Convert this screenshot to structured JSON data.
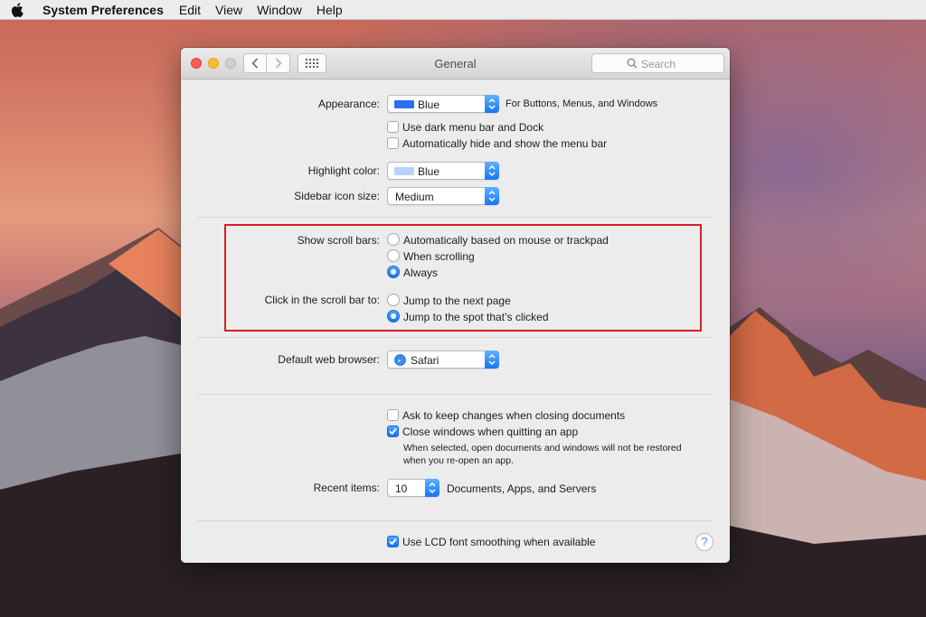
{
  "menubar": {
    "items": [
      "System Preferences",
      "Edit",
      "View",
      "Window",
      "Help"
    ]
  },
  "window": {
    "title": "General",
    "search_placeholder": "Search"
  },
  "appearance": {
    "label": "Appearance:",
    "value": "Blue",
    "note": "For Buttons, Menus, and Windows",
    "swatch_color": "#2d6ff2"
  },
  "dark_menu": {
    "label": "Use dark menu bar and Dock",
    "checked": false
  },
  "auto_hide": {
    "label": "Automatically hide and show the menu bar",
    "checked": false
  },
  "highlight": {
    "label": "Highlight color:",
    "value": "Blue",
    "swatch_color": "#b4d4fa"
  },
  "sidebar_size": {
    "label": "Sidebar icon size:",
    "value": "Medium"
  },
  "scroll_bars": {
    "label": "Show scroll bars:",
    "options": [
      "Automatically based on mouse or trackpad",
      "When scrolling",
      "Always"
    ],
    "selected": 2
  },
  "scroll_click": {
    "label": "Click in the scroll bar to:",
    "options": [
      "Jump to the next page",
      "Jump to the spot that’s clicked"
    ],
    "selected": 1
  },
  "browser": {
    "label": "Default web browser:",
    "value": "Safari"
  },
  "ask_keep": {
    "label": "Ask to keep changes when closing documents",
    "checked": false
  },
  "close_windows": {
    "label": "Close windows when quitting an app",
    "checked": true,
    "note_line1": "When selected, open documents and windows will not be restored",
    "note_line2": "when you re-open an app."
  },
  "recent": {
    "label": "Recent items:",
    "value": "10",
    "suffix": "Documents, Apps, and Servers"
  },
  "lcd": {
    "label": "Use LCD font smoothing when available",
    "checked": true
  },
  "help_label": "?",
  "colors": {
    "accent": "#1870f3",
    "highlight_border": "#d61f26",
    "close_light": "#fc5b57",
    "min_light": "#fdbc2e"
  }
}
